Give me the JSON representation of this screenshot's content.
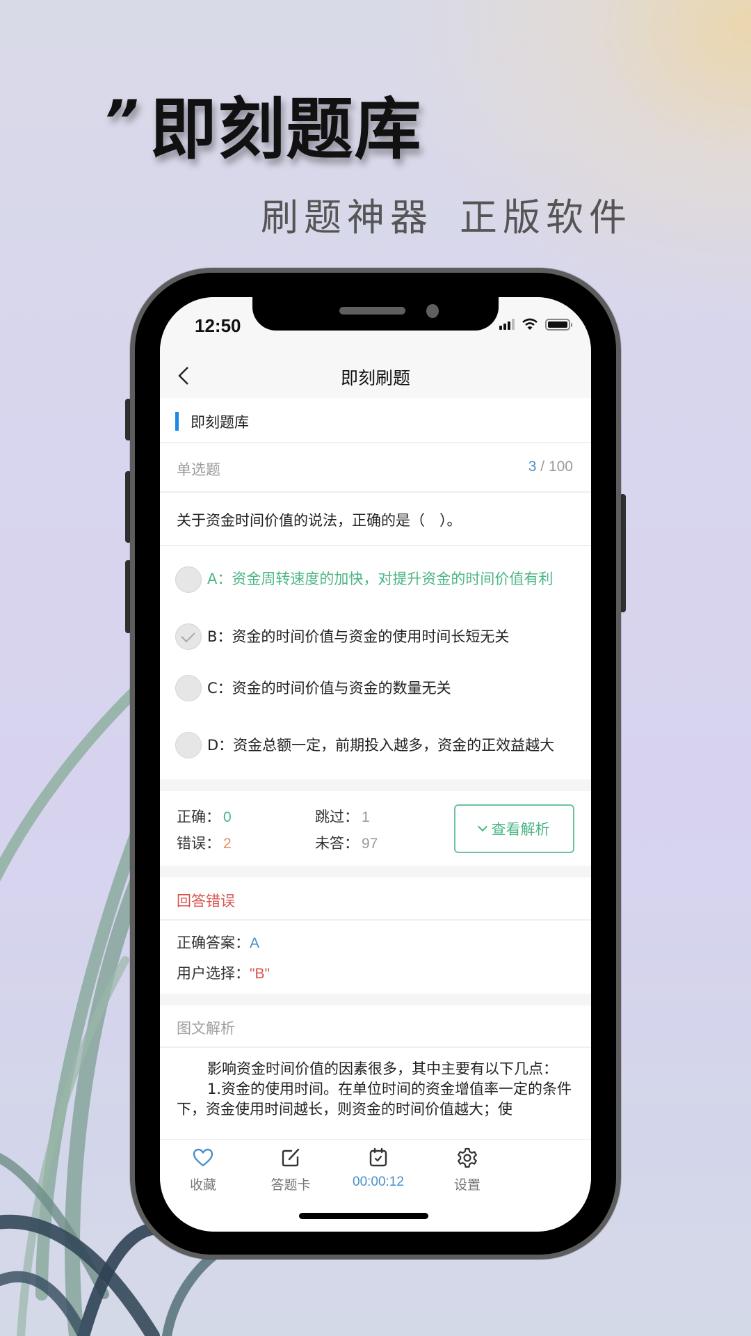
{
  "hero": {
    "quote_mark": "”",
    "title": "即刻题库",
    "subtitle_1": "刷题神器",
    "subtitle_2": "正版软件"
  },
  "status_bar": {
    "time": "12:50",
    "icons": [
      "signal-icon",
      "wifi-icon",
      "battery-icon"
    ]
  },
  "navbar": {
    "back_icon": "chevron-left-icon",
    "title": "即刻刷题"
  },
  "bank": {
    "label": "即刻题库",
    "accent_color": "#1e88e5"
  },
  "question_meta": {
    "type": "单选题",
    "current": "3",
    "separator": " / ",
    "total": "100"
  },
  "question": {
    "text": "关于资金时间价值的说法，正确的是（　）。",
    "options": [
      {
        "key": "A",
        "text": "A：资金周转速度的加快，对提升资金的时间价值有利",
        "state": "correct"
      },
      {
        "key": "B",
        "text": "B：资金的时间价值与资金的使用时间长短无关",
        "state": "selected"
      },
      {
        "key": "C",
        "text": "C：资金的时间价值与资金的数量无关",
        "state": "none"
      },
      {
        "key": "D",
        "text": "D：资金总额一定，前期投入越多，资金的正效益越大",
        "state": "none"
      }
    ]
  },
  "stats": {
    "correct_label": "正确：",
    "correct_value": "0",
    "wrong_label": "错误：",
    "wrong_value": "2",
    "skipped_label": "跳过：",
    "skipped_value": "1",
    "unanswered_label": "未答：",
    "unanswered_value": "97",
    "analysis_button": "查看解析"
  },
  "result": {
    "status": "回答错误",
    "correct_answer_label": "正确答案：",
    "correct_answer_value": "A",
    "user_choice_label": "用户选择：",
    "user_choice_value": "\"B\""
  },
  "explanation": {
    "heading": "图文解析",
    "paragraphs": [
      "影响资金时间价值的因素很多，其中主要有以下几点：",
      "1.资金的使用时间。在单位时间的资金增值率一定的条件下，资金使用时间越长，则资金的时间价值越大；使"
    ]
  },
  "tabbar": {
    "items": [
      {
        "label": "收藏",
        "icon": "heart-icon"
      },
      {
        "label": "答题卡",
        "icon": "edit-icon"
      },
      {
        "label": "00:00:12",
        "icon": "calendar-check-icon"
      },
      {
        "label": "设置",
        "icon": "gear-icon"
      }
    ]
  },
  "colors": {
    "correct_green": "#4cb585",
    "wrong_orange": "#ef8a5d",
    "error_red": "#d9534f",
    "link_blue": "#4a90c8"
  }
}
